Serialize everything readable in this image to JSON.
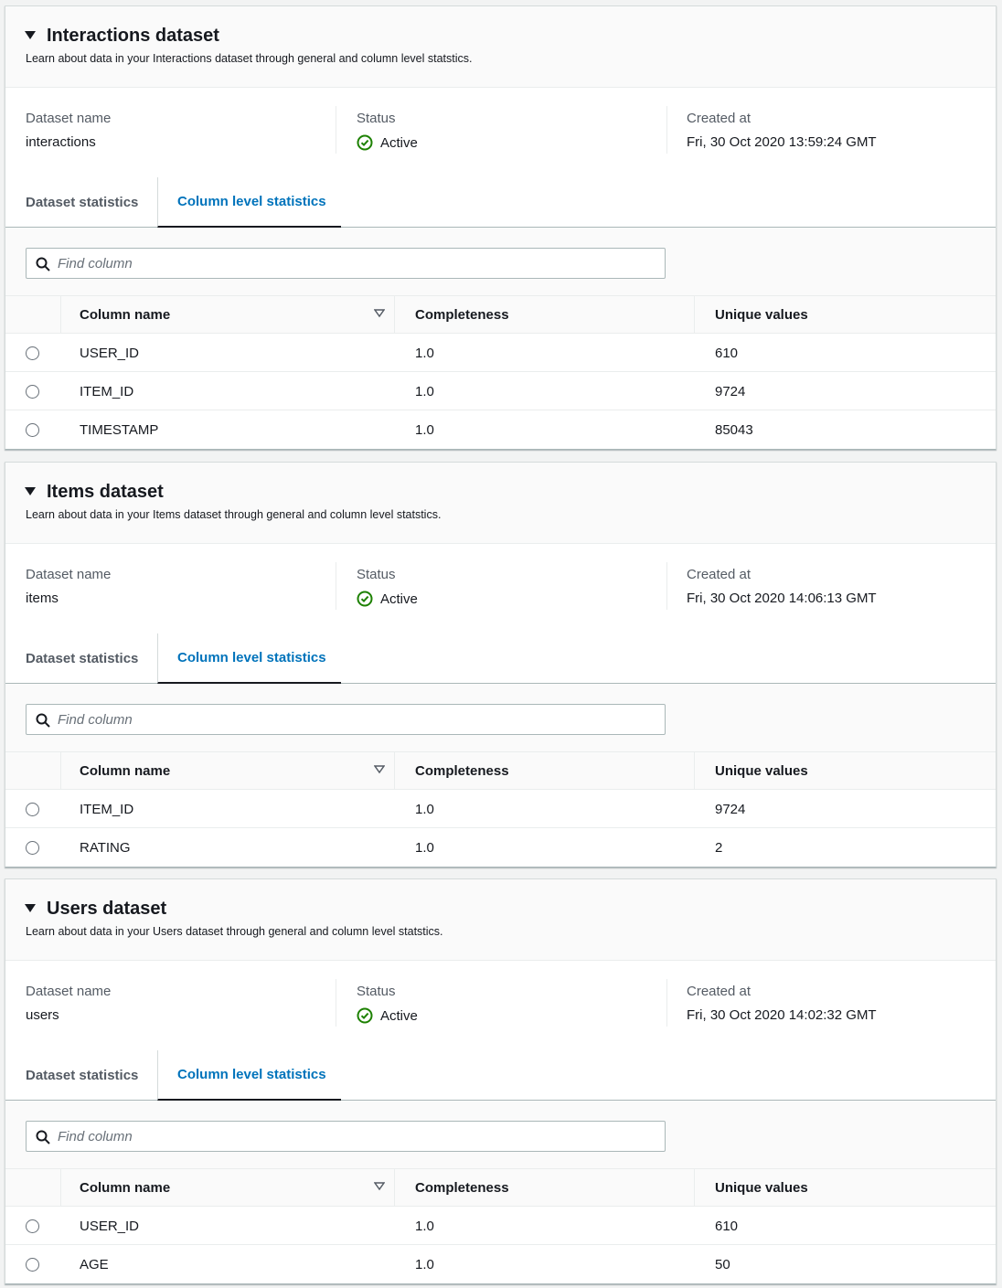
{
  "panels": [
    {
      "title": "Interactions dataset",
      "description": "Learn about data in your Interactions dataset through general and column level statstics.",
      "summary": {
        "name_label": "Dataset name",
        "name_value": "interactions",
        "status_label": "Status",
        "status_value": "Active",
        "created_label": "Created at",
        "created_value": "Fri, 30 Oct 2020 13:59:24 GMT"
      },
      "tabs": [
        "Dataset statistics",
        "Column level statistics"
      ],
      "search_placeholder": "Find column",
      "headers": [
        "Column name",
        "Completeness",
        "Unique values"
      ],
      "rows": [
        [
          "USER_ID",
          "1.0",
          "610"
        ],
        [
          "ITEM_ID",
          "1.0",
          "9724"
        ],
        [
          "TIMESTAMP",
          "1.0",
          "85043"
        ]
      ]
    },
    {
      "title": "Items dataset",
      "description": "Learn about data in your Items dataset through general and column level statstics.",
      "summary": {
        "name_label": "Dataset name",
        "name_value": "items",
        "status_label": "Status",
        "status_value": "Active",
        "created_label": "Created at",
        "created_value": "Fri, 30 Oct 2020 14:06:13 GMT"
      },
      "tabs": [
        "Dataset statistics",
        "Column level statistics"
      ],
      "search_placeholder": "Find column",
      "headers": [
        "Column name",
        "Completeness",
        "Unique values"
      ],
      "rows": [
        [
          "ITEM_ID",
          "1.0",
          "9724"
        ],
        [
          "RATING",
          "1.0",
          "2"
        ]
      ]
    },
    {
      "title": "Users dataset",
      "description": "Learn about data in your Users dataset through general and column level statstics.",
      "summary": {
        "name_label": "Dataset name",
        "name_value": "users",
        "status_label": "Status",
        "status_value": "Active",
        "created_label": "Created at",
        "created_value": "Fri, 30 Oct 2020 14:02:32 GMT"
      },
      "tabs": [
        "Dataset statistics",
        "Column level statistics"
      ],
      "search_placeholder": "Find column",
      "headers": [
        "Column name",
        "Completeness",
        "Unique values"
      ],
      "rows": [
        [
          "USER_ID",
          "1.0",
          "610"
        ],
        [
          "AGE",
          "1.0",
          "50"
        ]
      ]
    }
  ],
  "colors": {
    "accent": "#0073bb",
    "status_active": "#1d8102",
    "text": "#16191f",
    "label": "#545b64"
  },
  "icons": {
    "caret": "caret-down-icon",
    "status": "status-positive-icon",
    "search": "search-icon",
    "sort": "sort-icon"
  }
}
